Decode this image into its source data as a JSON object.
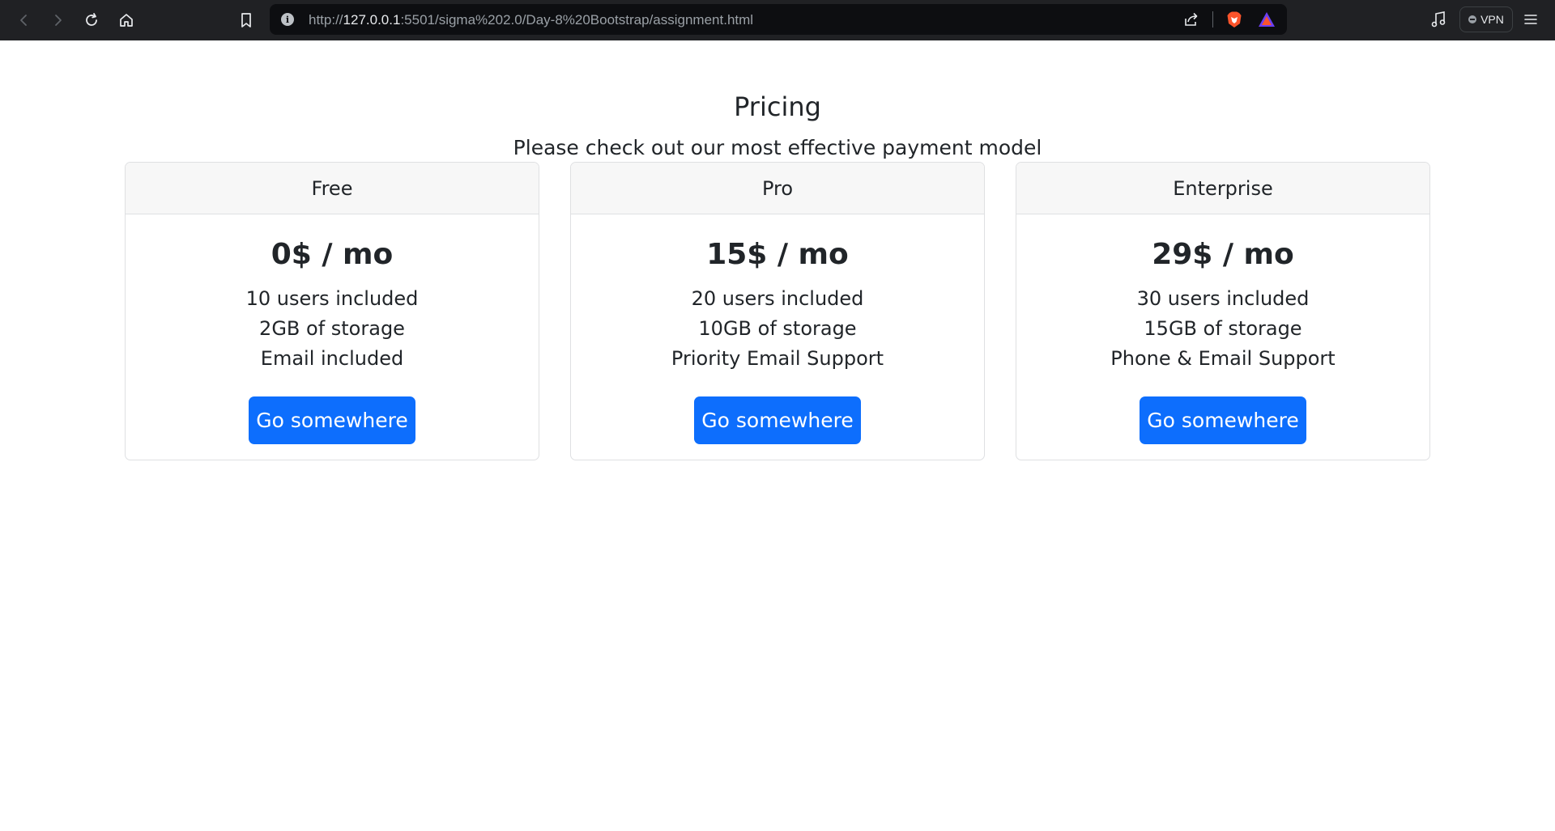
{
  "browser": {
    "url_scheme": "http://",
    "url_host": "127.0.0.1",
    "url_path": ":5501/sigma%202.0/Day-8%20Bootstrap/assignment.html",
    "vpn_label": "VPN",
    "icons": [
      "back-icon",
      "forward-icon",
      "reload-icon",
      "home-icon",
      "bookmark-icon",
      "info-icon",
      "share-icon",
      "brave-shield-icon",
      "brave-rewards-icon",
      "music-icon",
      "vpn-icon",
      "menu-icon"
    ]
  },
  "page": {
    "title": "Pricing",
    "subtitle": "Please check out our most effective payment model"
  },
  "plans": [
    {
      "name": "Free",
      "price": "0$ / mo",
      "features": [
        "10 users included",
        "2GB of storage",
        "Email included"
      ],
      "button": "Go somewhere"
    },
    {
      "name": "Pro",
      "price": "15$ / mo",
      "features": [
        "20 users included",
        "10GB of storage",
        "Priority Email Support"
      ],
      "button": "Go somewhere"
    },
    {
      "name": "Enterprise",
      "price": "29$ / mo",
      "features": [
        "30 users included",
        "15GB of storage",
        "Phone & Email Support"
      ],
      "button": "Go somewhere"
    }
  ],
  "colors": {
    "chrome_bg": "#202124",
    "urlbar_bg": "#0d0e11",
    "button_primary": "#0d6efd",
    "card_header_bg": "#f7f7f7",
    "card_border": "#dfe0e2"
  }
}
